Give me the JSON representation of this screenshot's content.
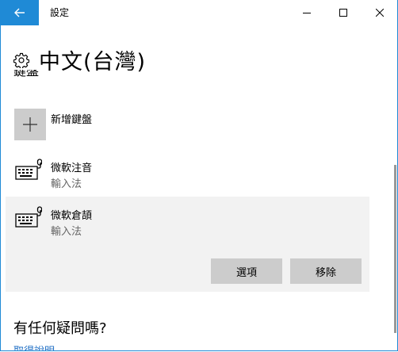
{
  "titlebar": {
    "title": "設定",
    "back_icon": "arrow-left-icon",
    "accent": "#1f8ad6"
  },
  "header": {
    "title": "中文(台灣)",
    "icon": "gear-icon"
  },
  "clipped_section_label": "鍵盤",
  "add_keyboard": {
    "label": "新增鍵盤",
    "icon": "plus-icon"
  },
  "keyboards": [
    {
      "name": "微軟注音",
      "type": "輸入法",
      "icon": "keyboard-icon"
    },
    {
      "name": "微軟倉頡",
      "type": "輸入法",
      "icon": "keyboard-icon"
    }
  ],
  "selected_actions": {
    "options_label": "選項",
    "remove_label": "移除"
  },
  "help": {
    "title": "有任何疑問嗎?",
    "link": "取得說明"
  }
}
